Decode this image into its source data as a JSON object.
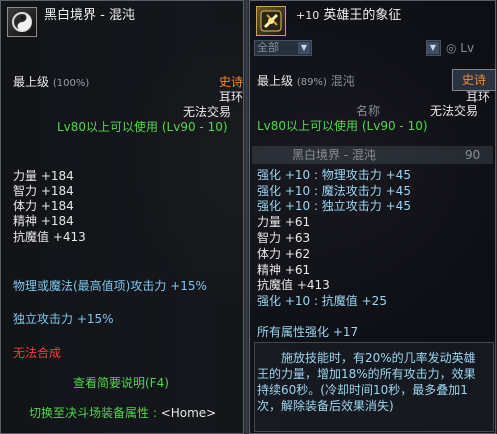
{
  "left": {
    "name": "黑白境界 - 混沌",
    "grade": "最上级",
    "grade_pct": "(100%)",
    "rarity": "史诗",
    "slot": "耳环",
    "trade": "无法交易",
    "level_req": "Lv80以上可以使用 (Lv90 - 10)",
    "stats": [
      {
        "label": "力量",
        "value": "+184"
      },
      {
        "label": "智力",
        "value": "+184"
      },
      {
        "label": "体力",
        "value": "+184"
      },
      {
        "label": "精神",
        "value": "+184"
      },
      {
        "label": "抗魔值",
        "value": "+413"
      }
    ],
    "attack_all": {
      "label": "物理或魔法(最高值项)攻击力",
      "value": "+15%"
    },
    "attack_indep": {
      "label": "独立攻击力",
      "value": "+15%"
    },
    "no_synthesis": "无法合成",
    "view_desc": "查看简要说明(F4)",
    "switch_text": "切换至决斗场装备属性 : ",
    "switch_key": "<Home>"
  },
  "right": {
    "enhance": "+10",
    "name": "英雄王的象征",
    "dropdown1": "全部",
    "dropdown2_badge": "Lv",
    "grade": "最上级",
    "grade_pct": "(89%)",
    "grade_ghost": "混沌",
    "rarity_button": "史诗",
    "slot": "耳环",
    "trade": "无法交易",
    "ghost_name": "名称",
    "level_req": "Lv80以上可以使用 (Lv90 - 10)",
    "row_item": "黑白境界 - 混沌",
    "row_level": "90",
    "stats": [
      "强化 +10 : 物理攻击力 +45",
      "强化 +10 : 魔法攻击力 +45",
      "强化 +10 : 独立攻击力 +45",
      "力量 +61",
      "智力 +63",
      "体力 +62",
      "精神 +61",
      "抗魔值 +413",
      "强化 +10 : 抗魔值 +25"
    ],
    "all_attr": "所有属性强化 +17",
    "description": "施放技能时，有20%的几率发动英雄王的力量，增加18%的所有攻击力，效果持续60秒。(冷却时间10秒，最多叠加1次，解除装备后效果消失)"
  },
  "colors": {
    "epic": "#f58a2e",
    "green": "#52d64f",
    "cyan": "#7ec7ef",
    "red": "#ff3b3b"
  },
  "icons": [
    "item-icon-chaos-earring",
    "item-icon-hero-king-symbol",
    "dropdown-arrow-icon"
  ]
}
